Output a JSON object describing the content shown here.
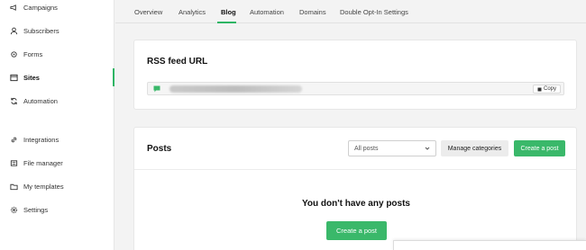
{
  "sidebar": {
    "items": [
      {
        "label": "Campaigns",
        "icon": "megaphone-icon"
      },
      {
        "label": "Subscribers",
        "icon": "user-icon"
      },
      {
        "label": "Forms",
        "icon": "gear-icon"
      },
      {
        "label": "Sites",
        "icon": "browser-icon"
      },
      {
        "label": "Automation",
        "icon": "refresh-icon"
      },
      {
        "label": "Integrations",
        "icon": "link-icon"
      },
      {
        "label": "File manager",
        "icon": "file-icon"
      },
      {
        "label": "My templates",
        "icon": "folder-icon"
      },
      {
        "label": "Settings",
        "icon": "settings-icon"
      }
    ],
    "active": "Sites"
  },
  "tabs": {
    "items": [
      "Overview",
      "Analytics",
      "Blog",
      "Automation",
      "Domains",
      "Double Opt-In Settings"
    ],
    "active": "Blog"
  },
  "rss": {
    "title": "RSS feed URL",
    "copy_label": "Copy"
  },
  "posts": {
    "title": "Posts",
    "filter_value": "All posts",
    "manage_label": "Manage categories",
    "create_label": "Create a post",
    "empty_message": "You don't have any posts",
    "empty_create_label": "Create a post"
  },
  "colors": {
    "accent": "#2db564",
    "button_green": "#3ab86a"
  }
}
